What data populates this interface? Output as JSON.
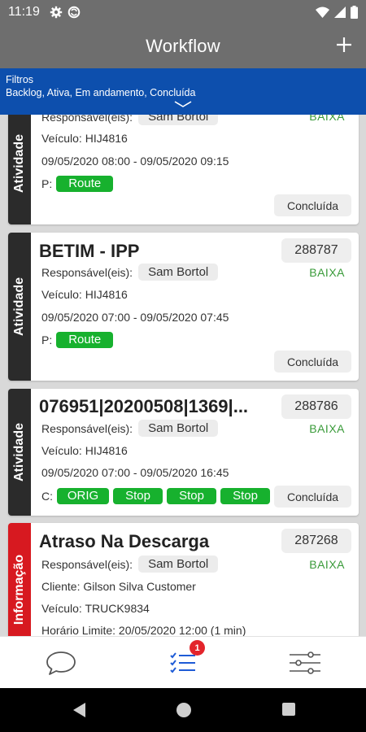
{
  "status_bar": {
    "time": "11:19"
  },
  "app_bar": {
    "title": "Workflow"
  },
  "filters": {
    "label": "Filtros",
    "value": "Backlog, Ativa, Em andamento, Concluída"
  },
  "cards": [
    {
      "side_label": "Atividade",
      "responsible_label": "Responsável(eis):",
      "responsible": "Sam Bortol",
      "priority": "BAIXA",
      "vehicle": "Veículo: HIJ4816",
      "time_range": "09/05/2020 08:00 - 09/05/2020 09:15",
      "tags_prefix": "P:",
      "tags": [
        "Route"
      ],
      "status": "Concluída"
    },
    {
      "side_label": "Atividade",
      "title": "BETIM - IPP",
      "number": "288787",
      "responsible_label": "Responsável(eis):",
      "responsible": "Sam Bortol",
      "priority": "BAIXA",
      "vehicle": "Veículo: HIJ4816",
      "time_range": "09/05/2020 07:00 - 09/05/2020 07:45",
      "tags_prefix": "P:",
      "tags": [
        "Route"
      ],
      "status": "Concluída"
    },
    {
      "side_label": "Atividade",
      "title": "076951|20200508|1369|...",
      "number": "288786",
      "responsible_label": "Responsável(eis):",
      "responsible": "Sam Bortol",
      "priority": "BAIXA",
      "vehicle": "Veículo: HIJ4816",
      "time_range": "09/05/2020 07:00 - 09/05/2020 16:45",
      "tags_prefix": "C:",
      "tags": [
        "ORIG",
        "Stop",
        "Stop",
        "Stop"
      ],
      "status": "Concluída"
    },
    {
      "side_label": "Informação",
      "title": "Atraso Na Descarga",
      "number": "287268",
      "responsible_label": "Responsável(eis):",
      "responsible": "Sam Bortol",
      "priority": "BAIXA",
      "client": "Cliente: Gilson Silva Customer",
      "vehicle": "Veículo: TRUCK9834",
      "deadline": "Horário Limite: 20/05/2020 12:00 (1 min)"
    }
  ],
  "bottom_nav": {
    "badge_count": "1"
  },
  "colors": {
    "app_bar": "#6e6e6e",
    "filter_bar": "#0d4fad",
    "tag_green": "#17b12e",
    "priority_green": "#3a9b3a",
    "info_red": "#d71920",
    "nav_blue": "#1e5bd6"
  },
  "icons": [
    "settings-icon",
    "sync-icon",
    "wifi-icon",
    "signal-icon",
    "battery-icon",
    "add-icon",
    "chevron-down-icon",
    "chat-icon",
    "task-list-icon",
    "filter-sliders-icon",
    "back-icon",
    "home-icon",
    "recents-icon"
  ]
}
